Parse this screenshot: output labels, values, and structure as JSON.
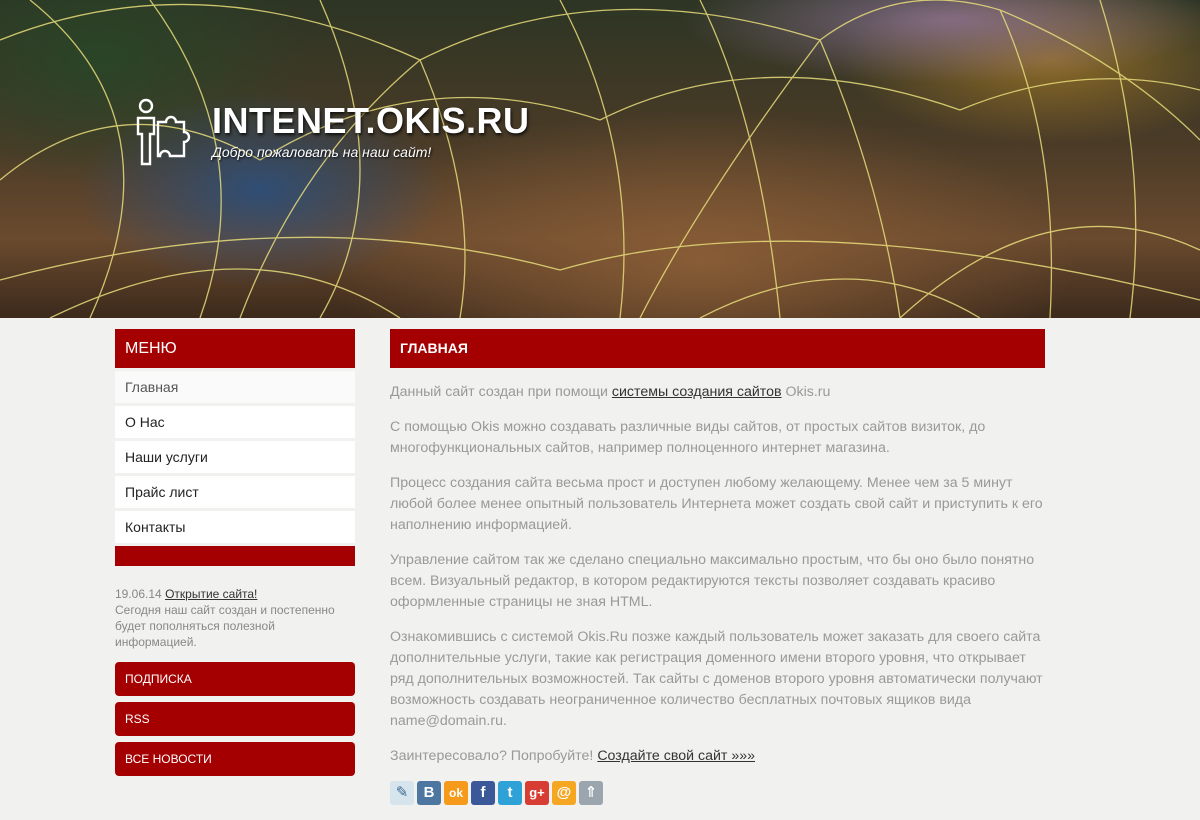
{
  "header": {
    "title": "INTENET.OKIS.RU",
    "slogan": "Добро пожаловать на наш сайт!"
  },
  "sidebar": {
    "menu_title": "МЕНЮ",
    "items": [
      {
        "label": "Главная"
      },
      {
        "label": "О Нас"
      },
      {
        "label": "Наши услуги"
      },
      {
        "label": "Прайс лист"
      },
      {
        "label": "Контакты"
      }
    ],
    "news": {
      "date": "19.06.14",
      "link": "Открытие сайта!",
      "text": "Сегодня наш сайт создан и постепенно будет пополняться полезной информацией."
    },
    "buttons": [
      "ПОДПИСКА",
      "RSS",
      "ВСЕ НОВОСТИ"
    ]
  },
  "main": {
    "heading": "ГЛАВНАЯ",
    "p1_pre": "Данный сайт создан при помощи ",
    "p1_link": "системы создания сайтов",
    "p1_post": " Okis.ru",
    "p2": "С помощью Okis можно создавать различные виды сайтов, от простых сайтов визиток, до многофункциональных сайтов, например полноценного интернет магазина.",
    "p3": "Процесс создания сайта весьма прост и доступен любому желающему. Менее чем за 5 минут любой более менее опытный пользователь Интернета может создать свой сайт и приступить к его наполнению информацией.",
    "p4": "Управление сайтом так же сделано специально максимально простым, что бы оно было понятно всем. Визуальный редактор, в котором редактируются тексты позволяет создавать красиво оформленные страницы не зная HTML.",
    "p5": "Ознакомившись с системой Okis.Ru позже каждый пользователь может заказать для своего сайта дополнительные услуги, такие как регистрация доменного имени второго уровня, что открывает ряд дополнительных возможностей. Так сайты с доменов второго уровня автоматически получают возможность создавать неограниченное количество бесплатных почтовых ящиков вида name@domain.ru.",
    "p6_pre": "Заинтересовало? Попробуйте! ",
    "p6_link": "Создайте свой сайт »»»"
  },
  "share": [
    {
      "icon": "livejournal-icon",
      "glyph": "✎",
      "color": "#d6e4ee"
    },
    {
      "icon": "vkontakte-icon",
      "glyph": "B",
      "color": "#4d76a1"
    },
    {
      "icon": "odnoklassniki-icon",
      "glyph": "ok",
      "color": "#f59a1b"
    },
    {
      "icon": "facebook-icon",
      "glyph": "f",
      "color": "#3b5998"
    },
    {
      "icon": "twitter-icon",
      "glyph": "t",
      "color": "#2ea1d6"
    },
    {
      "icon": "googleplus-icon",
      "glyph": "g+",
      "color": "#d73d32"
    },
    {
      "icon": "mailru-icon",
      "glyph": "@",
      "color": "#f5a623"
    },
    {
      "icon": "more-icon",
      "glyph": "⇑",
      "color": "#9aa5ad"
    }
  ],
  "colors": {
    "accent": "#a50001",
    "background": "#f1f1ef"
  }
}
